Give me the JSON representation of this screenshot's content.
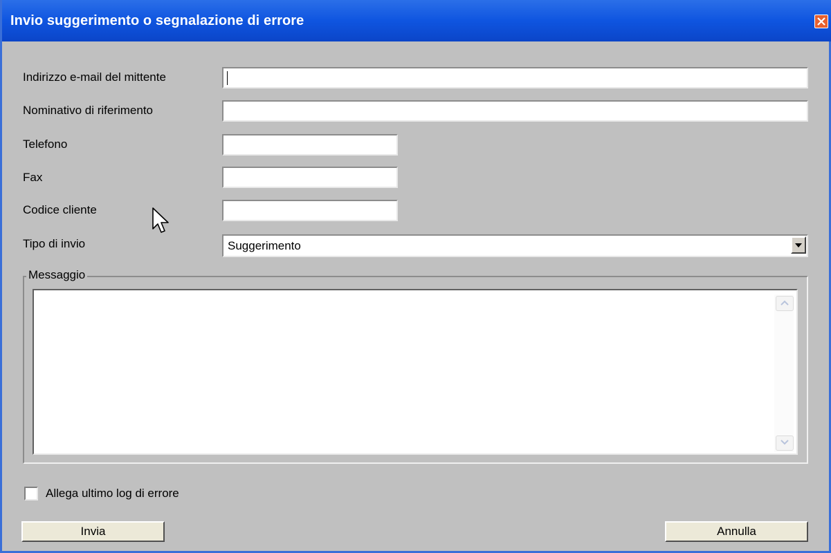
{
  "window": {
    "title": "Invio suggerimento o segnalazione di errore"
  },
  "form": {
    "email_label": "Indirizzo e-mail del mittente",
    "email_value": "",
    "name_label": "Nominativo di riferimento",
    "name_value": "",
    "phone_label": "Telefono",
    "phone_value": "",
    "fax_label": "Fax",
    "fax_value": "",
    "customer_code_label": "Codice cliente",
    "customer_code_value": "",
    "send_type_label": "Tipo di invio",
    "send_type_value": "Suggerimento",
    "message_group_label": "Messaggio",
    "message_value": "",
    "attach_log_label": "Allega ultimo log di errore",
    "attach_log_checked": false
  },
  "buttons": {
    "send": "Invia",
    "cancel": "Annulla"
  },
  "icons": {
    "close": "close-icon",
    "dropdown": "chevron-down-icon",
    "cursor": "mouse-pointer-icon"
  },
  "colors": {
    "title_bar": "#0f55e0",
    "dialog_bg": "#c0c0c0",
    "close_button": "#e8612f"
  }
}
